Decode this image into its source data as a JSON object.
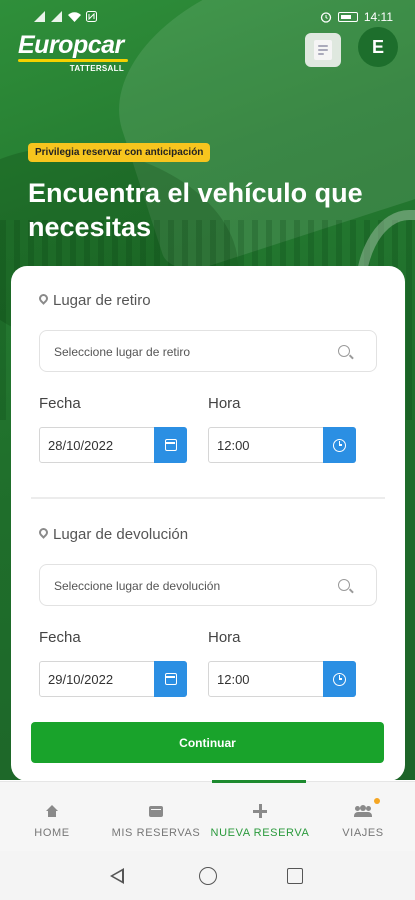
{
  "status_bar": {
    "time": "14:11",
    "icons": [
      "signal-icon",
      "wifi-icon",
      "nfc-icon",
      "alarm-icon",
      "battery-icon"
    ]
  },
  "header": {
    "logo_text": "Europcar",
    "logo_subtext": "TATTERSALL",
    "avatar_initial": "E",
    "colors": {
      "brand_green": "#1d6e2c",
      "logo_accent": "#f5d100"
    }
  },
  "hero": {
    "badge": "Privilegia reservar con anticipación",
    "title": "Encuentra el vehículo que necesitas"
  },
  "pickup": {
    "section_label": "Lugar de retiro",
    "search_placeholder": "Seleccione lugar de retiro",
    "date_label": "Fecha",
    "date_value": "28/10/2022",
    "time_label": "Hora",
    "time_value": "12:00"
  },
  "return": {
    "section_label": "Lugar de devolución",
    "search_placeholder": "Seleccione lugar de devolución",
    "date_label": "Fecha",
    "date_value": "29/10/2022",
    "time_label": "Hora",
    "time_value": "12:00"
  },
  "continue_label": "Continuar",
  "bottom_nav": {
    "items": [
      {
        "label": "HOME",
        "icon": "home-icon"
      },
      {
        "label": "MIS RESERVAS",
        "icon": "wallet-icon"
      },
      {
        "label": "NUEVA RESERVA",
        "icon": "plus-icon",
        "active": true
      },
      {
        "label": "VIAJES",
        "icon": "people-icon",
        "notification": true
      }
    ],
    "active_color": "#2a9a3c"
  },
  "accent_colors": {
    "button_green": "#19a32b",
    "picker_blue": "#2b8fe3",
    "badge_yellow": "#f7c51e"
  }
}
